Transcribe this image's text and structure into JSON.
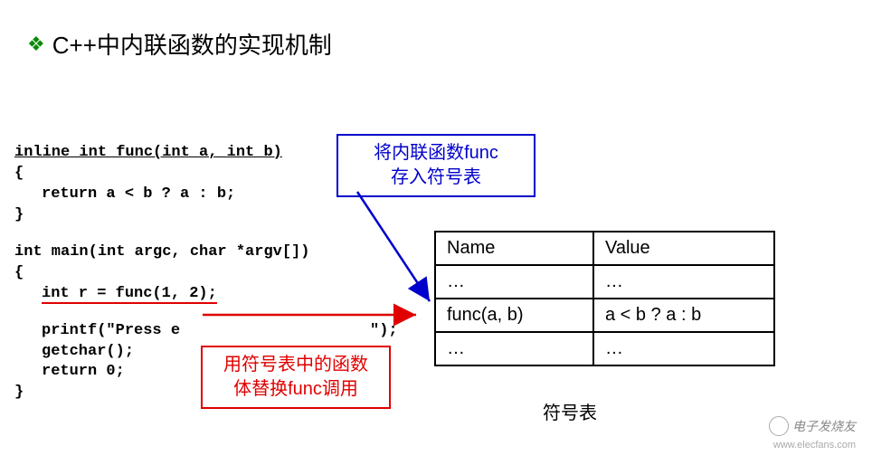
{
  "title": "C++中内联函数的实现机制",
  "bullet": "❖",
  "code": {
    "sig": "inline int func(int a, int b)",
    "brace_open": "{",
    "ret": "return a < b ? a : b;",
    "brace_close": "}",
    "main_sig": "int main(int argc, char *argv[])",
    "brace_open2": "{",
    "call": "int r = func(1, 2);",
    "printf_left": "printf(\"Press e",
    "printf_right": "\");",
    "getchar": "getchar();",
    "ret0": "return 0;",
    "brace_close2": "}"
  },
  "box_blue": {
    "line1": "将内联函数func",
    "line2": "存入符号表"
  },
  "box_red": {
    "line1": "用符号表中的函数",
    "line2": "体替换func调用"
  },
  "table": {
    "headers": {
      "name": "Name",
      "value": "Value"
    },
    "rows": [
      {
        "name": "…",
        "value": "…"
      },
      {
        "name": "func(a, b)",
        "value": "a < b ? a : b"
      },
      {
        "name": "…",
        "value": "…"
      }
    ],
    "caption": "符号表"
  },
  "watermark": {
    "text": "电子发烧友",
    "url": "www.elecfans.com"
  }
}
